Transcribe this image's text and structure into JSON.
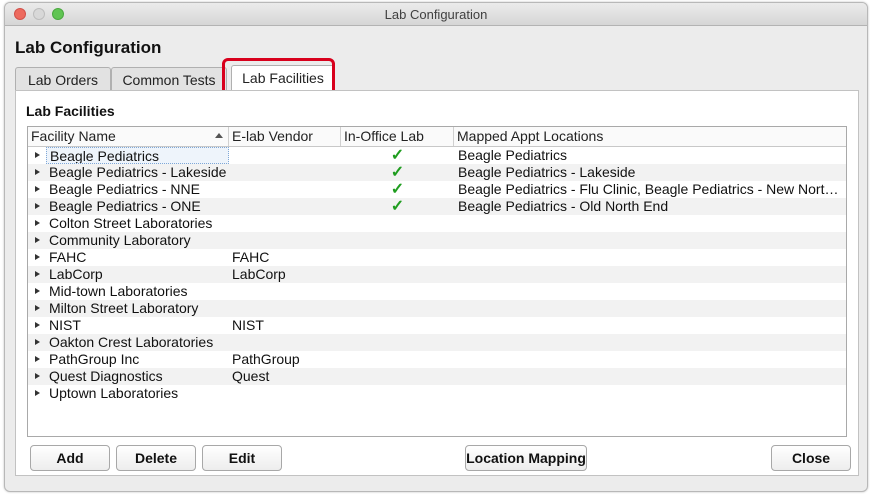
{
  "window": {
    "title": "Lab Configuration"
  },
  "page": {
    "heading": "Lab Configuration"
  },
  "tabs": [
    {
      "label": "Lab Orders"
    },
    {
      "label": "Common Tests"
    },
    {
      "label": "Lab Facilities"
    }
  ],
  "panel": {
    "title": "Lab Facilities"
  },
  "table": {
    "columns": [
      "Facility Name",
      "E-lab Vendor",
      "In-Office Lab",
      "Mapped Appt Locations"
    ],
    "checkmark": "✓",
    "rows": [
      {
        "name": "Beagle Pediatrics",
        "vendor": "",
        "lab": "✓",
        "locations": "Beagle Pediatrics"
      },
      {
        "name": "Beagle Pediatrics - Lakeside",
        "vendor": "",
        "lab": "✓",
        "locations": "Beagle Pediatrics - Lakeside"
      },
      {
        "name": "Beagle Pediatrics - NNE",
        "vendor": "",
        "lab": "✓",
        "locations": "Beagle Pediatrics - Flu Clinic, Beagle Pediatrics - New North ..."
      },
      {
        "name": "Beagle Pediatrics - ONE",
        "vendor": "",
        "lab": "✓",
        "locations": "Beagle Pediatrics - Old North End"
      },
      {
        "name": "Colton Street Laboratories",
        "vendor": "",
        "lab": "",
        "locations": ""
      },
      {
        "name": "Community Laboratory",
        "vendor": "",
        "lab": "",
        "locations": ""
      },
      {
        "name": "FAHC",
        "vendor": "FAHC",
        "lab": "",
        "locations": ""
      },
      {
        "name": "LabCorp",
        "vendor": "LabCorp",
        "lab": "",
        "locations": ""
      },
      {
        "name": "Mid-town Laboratories",
        "vendor": "",
        "lab": "",
        "locations": ""
      },
      {
        "name": "Milton Street Laboratory",
        "vendor": "",
        "lab": "",
        "locations": ""
      },
      {
        "name": "NIST",
        "vendor": "NIST",
        "lab": "",
        "locations": ""
      },
      {
        "name": "Oakton Crest Laboratories",
        "vendor": "",
        "lab": "",
        "locations": ""
      },
      {
        "name": "PathGroup Inc",
        "vendor": "PathGroup",
        "lab": "",
        "locations": ""
      },
      {
        "name": "Quest Diagnostics",
        "vendor": "Quest",
        "lab": "",
        "locations": ""
      },
      {
        "name": "Uptown Laboratories",
        "vendor": "",
        "lab": "",
        "locations": ""
      }
    ]
  },
  "buttons": {
    "add": "Add",
    "delete": "Delete",
    "edit": "Edit",
    "location_mapping": "Location Mapping",
    "close": "Close"
  },
  "colors": {
    "highlight": "#d8001c",
    "check": "#1f9d1f"
  }
}
